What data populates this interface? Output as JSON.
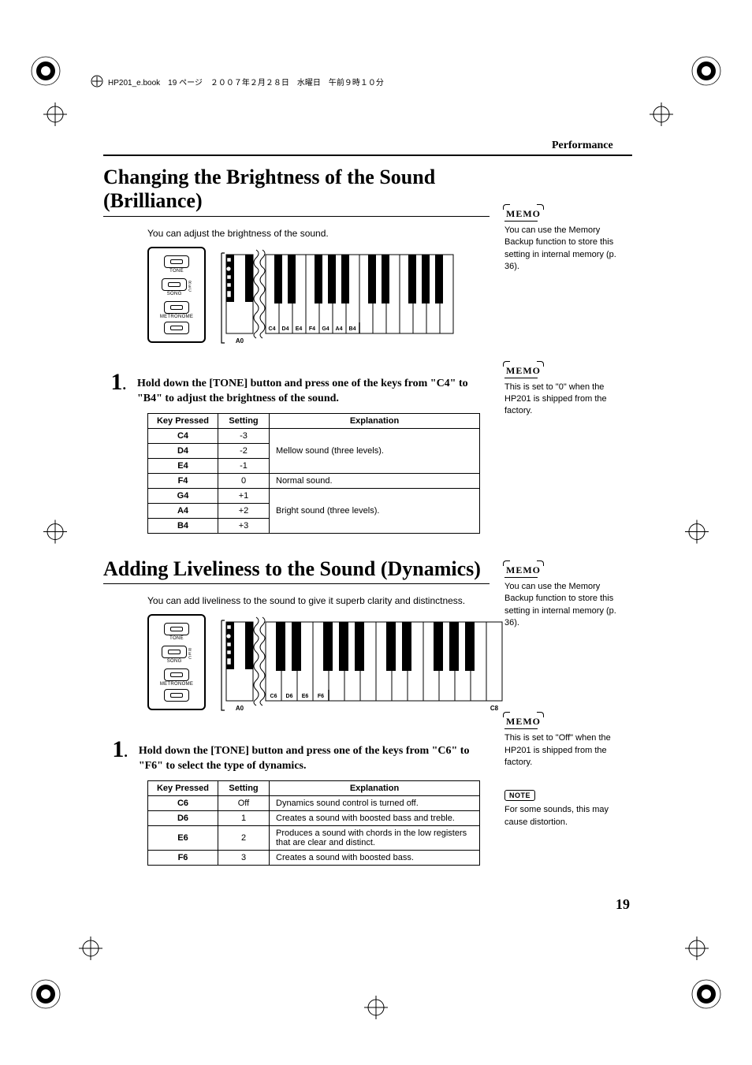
{
  "header": {
    "book_info": "HP201_e.book　19 ページ　２００７年２月２８日　水曜日　午前９時１０分",
    "chapter": "Performance"
  },
  "section1": {
    "title": "Changing the Brightness of the Sound (Brilliance)",
    "intro": "You can adjust the brightness of the sound.",
    "diagram": {
      "buttons": [
        "TONE",
        "SONG",
        "METRONOME"
      ],
      "rec_label": "REC",
      "a0_label": "A0",
      "key_labels": [
        "C4",
        "D4",
        "E4",
        "F4",
        "G4",
        "A4",
        "B4"
      ]
    },
    "step_num": "1",
    "step_text": "Hold down the [TONE] button and press one of the keys from \"C4\" to \"B4\" to adjust the brightness of the sound.",
    "table": {
      "headers": [
        "Key Pressed",
        "Setting",
        "Explanation"
      ],
      "rows": [
        {
          "key": "C4",
          "setting": "-3",
          "exp": "Mellow sound (three levels).",
          "span_start": true,
          "span": 3
        },
        {
          "key": "D4",
          "setting": "-2"
        },
        {
          "key": "E4",
          "setting": "-1"
        },
        {
          "key": "F4",
          "setting": "0",
          "exp": "Normal sound."
        },
        {
          "key": "G4",
          "setting": "+1",
          "exp": "Bright sound (three levels).",
          "span_start": true,
          "span": 3
        },
        {
          "key": "A4",
          "setting": "+2"
        },
        {
          "key": "B4",
          "setting": "+3"
        }
      ]
    },
    "memo1": {
      "label": "MEMO",
      "text": "You can use the Memory Backup function to store this setting in internal memory (p. 36)."
    },
    "memo2": {
      "label": "MEMO",
      "text": "This is set to \"0\" when the HP201 is shipped from the factory."
    }
  },
  "section2": {
    "title": "Adding Liveliness to the Sound (Dynamics)",
    "intro": "You can add liveliness to the sound to give it superb clarity and distinctness.",
    "diagram": {
      "buttons": [
        "TONE",
        "SONG",
        "METRONOME"
      ],
      "rec_label": "REC",
      "a0_label": "A0",
      "c8_label": "C8",
      "key_labels": [
        "C6",
        "D6",
        "E6",
        "F6"
      ]
    },
    "step_num": "1",
    "step_text": "Hold down the [TONE] button and press one of the keys from \"C6\" to \"F6\" to select the type of dynamics.",
    "table": {
      "headers": [
        "Key Pressed",
        "Setting",
        "Explanation"
      ],
      "rows": [
        {
          "key": "C6",
          "setting": "Off",
          "exp": "Dynamics sound control is turned off."
        },
        {
          "key": "D6",
          "setting": "1",
          "exp": "Creates a sound with boosted bass and treble."
        },
        {
          "key": "E6",
          "setting": "2",
          "exp": "Produces a sound with chords in the low registers that are clear and distinct."
        },
        {
          "key": "F6",
          "setting": "3",
          "exp": "Creates a sound with boosted bass."
        }
      ]
    },
    "memo1": {
      "label": "MEMO",
      "text": "You can use the Memory Backup function to store this setting in internal memory (p. 36)."
    },
    "memo2": {
      "label": "MEMO",
      "text": "This is set to \"Off\" when the HP201 is shipped from the factory."
    },
    "note": {
      "label": "NOTE",
      "text": "For some sounds, this may cause distortion."
    }
  },
  "page_number": "19"
}
